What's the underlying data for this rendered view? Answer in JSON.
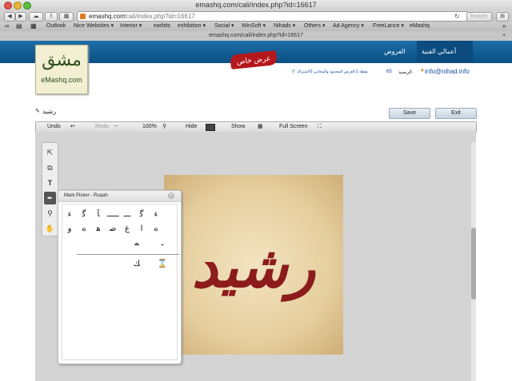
{
  "browser": {
    "title": "emashq.com/cali/index.php?id=16617",
    "url_host": "emashq.com",
    "url_path": "/cali/index.php?id=16617",
    "reader_label": "Reader",
    "tab_title": "emashq.com/cali/index.php?id=16617",
    "bookmarks": [
      {
        "label": "Outlook",
        "chevron": false
      },
      {
        "label": "Nice Websites",
        "chevron": true
      },
      {
        "label": "Interior",
        "chevron": true
      },
      {
        "label": "earbits",
        "chevron": false
      },
      {
        "label": "exhibition",
        "chevron": true
      },
      {
        "label": "Social",
        "chevron": true
      },
      {
        "label": "WinSoft",
        "chevron": true
      },
      {
        "label": "Nihads",
        "chevron": true
      },
      {
        "label": "Others",
        "chevron": true
      },
      {
        "label": "Ad Agency",
        "chevron": true
      },
      {
        "label": "FreeLance",
        "chevron": true
      },
      {
        "label": "eMashq",
        "chevron": false
      }
    ]
  },
  "site": {
    "logo_arabic": "مشق",
    "logo_latin": "eMashq.com",
    "nav_items": [
      "أعمالي الفنية",
      "العروض"
    ],
    "offer_badge": "عرض خاص",
    "user_email": "info@nihad.info",
    "balance_label": "الرصيد",
    "balance_value": "65",
    "points_text": "نقطة || العرض المحدود والمجاني (الاشتراك ؟)",
    "work_name": "رشيد",
    "save_label": "Save",
    "exit_label": "Exit"
  },
  "editor": {
    "undo_label": "Undo",
    "redo_label": "Redo",
    "zoom_label": "100%",
    "hide_label": "Hide",
    "show_label": "Show",
    "fullscreen_label": "Full Screen",
    "artwork_text": "رشيد",
    "tools": [
      "pointer-tool",
      "crop-tool",
      "text-tool",
      "mark-tool",
      "zoom-tool",
      "hand-tool"
    ],
    "picker": {
      "title": "Mark Picker - Ruqah",
      "marks_row1": [
        "ء",
        "ﮔ",
        "ـــ",
        "ـــــ",
        "ﺂ",
        "ﮔ",
        "ﺀ"
      ],
      "marks_row2": [
        "ه",
        "ا",
        "ﻍ",
        "ﺻ",
        "ﻫ",
        "ﻩ",
        "ﻭ"
      ],
      "marks_row3": [
        "ـ",
        "ﻤ"
      ],
      "marks_row4": [
        "ﻚ",
        "⌛"
      ]
    },
    "colors": {
      "brand_blue": "#0f5b92",
      "offer_red": "#b4171c",
      "artwork_red": "#8c1c1c"
    }
  }
}
